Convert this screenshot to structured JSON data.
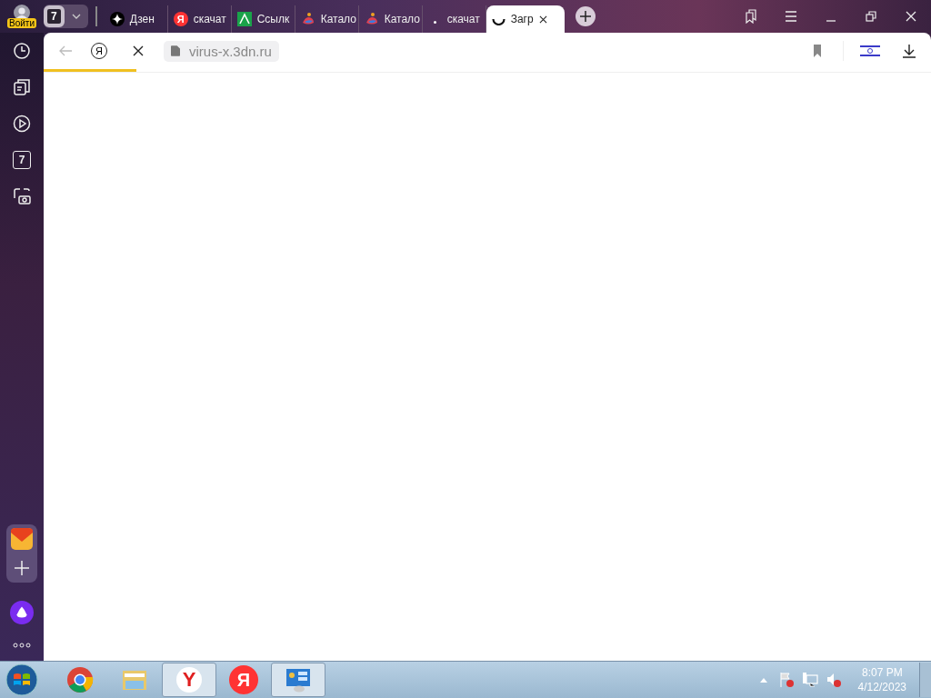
{
  "profile": {
    "label": "Войти"
  },
  "tab_count": "7",
  "tabs": [
    {
      "title": "Дзен",
      "kind": "star",
      "selected": false
    },
    {
      "title": "скачат",
      "kind": "ya",
      "letter": "Я",
      "selected": false
    },
    {
      "title": "Ссылк",
      "kind": "green",
      "selected": false
    },
    {
      "title": "Катало",
      "kind": "colorful",
      "selected": false
    },
    {
      "title": "Катало",
      "kind": "colorful",
      "selected": false
    },
    {
      "title": "скачат",
      "kind": "dot",
      "selected": false
    },
    {
      "title": "Загр",
      "kind": "spinner",
      "selected": true
    }
  ],
  "sidebar": [
    {
      "kind": "history"
    },
    {
      "kind": "collections"
    },
    {
      "kind": "video"
    },
    {
      "kind": "calendar",
      "text": "7"
    },
    {
      "kind": "screenshot"
    }
  ],
  "toolbar": {
    "logo_letter": "Я",
    "address": "virus-x.3dn.ru",
    "loading": true,
    "level": 0.105
  },
  "taskbar": {
    "apps": [
      {
        "kind": "chrome",
        "selected": false
      },
      {
        "kind": "explorer",
        "selected": false
      },
      {
        "kind": "ybrowser",
        "letter": "Y",
        "selected": true
      },
      {
        "kind": "ya",
        "letter": "Я",
        "selected": false
      },
      {
        "kind": "panel",
        "selected": true
      }
    ],
    "time": "8:07 PM",
    "date": "4/12/2023"
  }
}
